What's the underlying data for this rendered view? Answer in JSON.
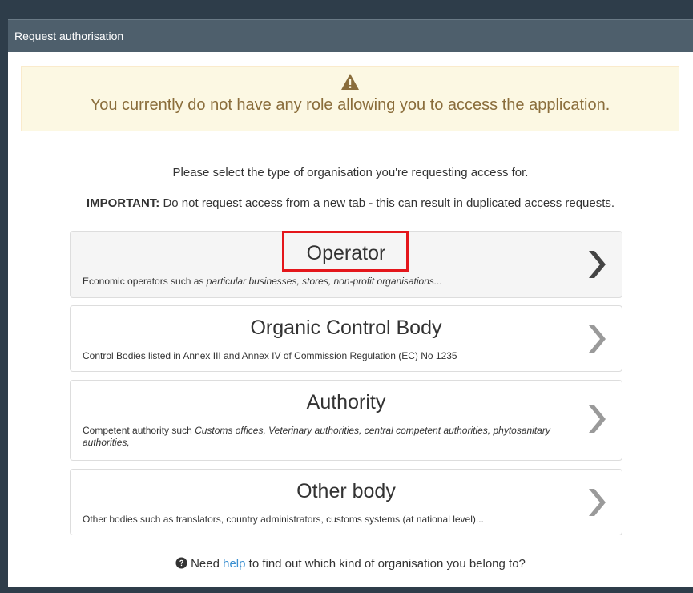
{
  "header": {
    "title": "Request authorisation"
  },
  "alert": {
    "icon": "warning-icon",
    "message": "You currently do not have any role allowing you to access the application."
  },
  "intro": {
    "line1": "Please select the type of organisation you're requesting access for.",
    "important_label": "IMPORTANT:",
    "important_text": " Do not request access from a new tab - this can result in duplicated access requests."
  },
  "options": [
    {
      "title": "Operator",
      "desc_plain": "Economic operators such as ",
      "desc_italic": "particular businesses, stores, non-profit organisations...",
      "selected": true,
      "icon": "chevron-right-icon"
    },
    {
      "title": "Organic Control Body",
      "desc_plain": "Control Bodies listed in Annex III and Annex IV of Commission Regulation (EC) No 1235",
      "desc_italic": "",
      "selected": false,
      "icon": "chevron-right-icon"
    },
    {
      "title": "Authority",
      "desc_plain": "Competent authority such ",
      "desc_italic": "Customs offices, Veterinary authorities, central competent authorities, phytosanitary authorities,",
      "selected": false,
      "icon": "chevron-right-icon"
    },
    {
      "title": "Other body",
      "desc_plain": "Other bodies such as translators, country administrators, customs systems (at national level)...",
      "desc_italic": "",
      "selected": false,
      "icon": "chevron-right-icon"
    }
  ],
  "help": {
    "icon": "question-circle-icon",
    "before": "Need ",
    "link": "help",
    "after": " to find out which kind of organisation you belong to?"
  },
  "colors": {
    "header_bg": "#4e5f6c",
    "alert_bg": "#fcf8e3",
    "alert_text": "#8a6d3b",
    "link": "#3a8fd0",
    "highlight": "#e4161b",
    "chevron_active": "#444444",
    "chevron_inactive": "#9a9a9a"
  }
}
